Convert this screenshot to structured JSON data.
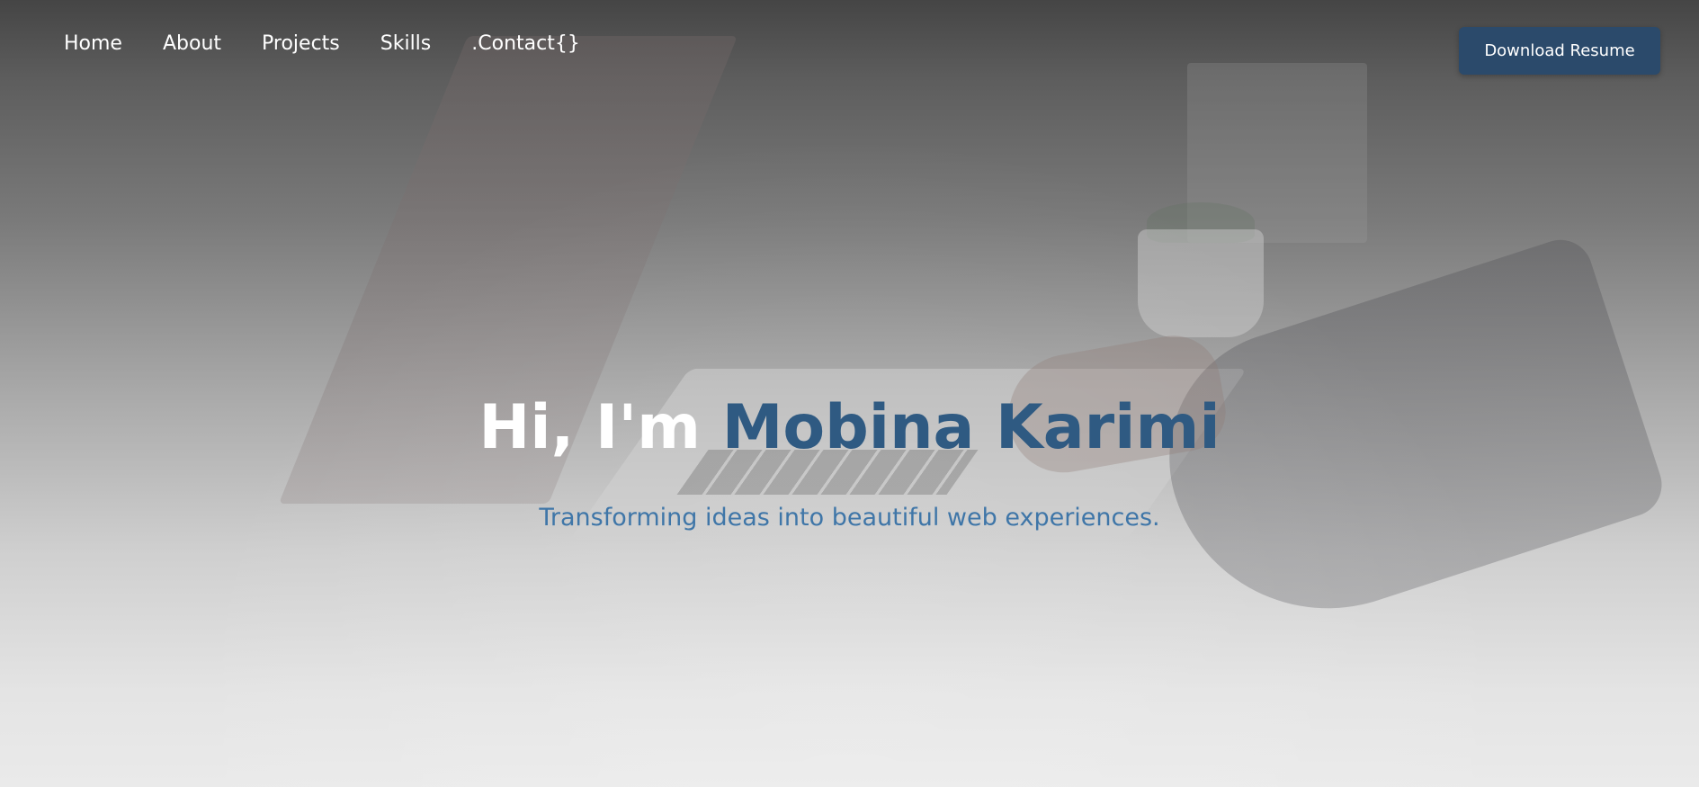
{
  "nav": {
    "items": [
      {
        "label": "Home"
      },
      {
        "label": "About"
      },
      {
        "label": "Projects"
      },
      {
        "label": "Skills"
      },
      {
        "label": ".Contact{}"
      }
    ]
  },
  "header": {
    "download_label": "Download Resume"
  },
  "hero": {
    "greeting": "Hi, I'm",
    "name": "Mobina Karimi",
    "subtitle": "Transforming ideas into beautiful web experiences."
  },
  "colors": {
    "accent": "#2f5a82",
    "subtitle": "#3f76a8",
    "button": "#2b4a6b"
  }
}
